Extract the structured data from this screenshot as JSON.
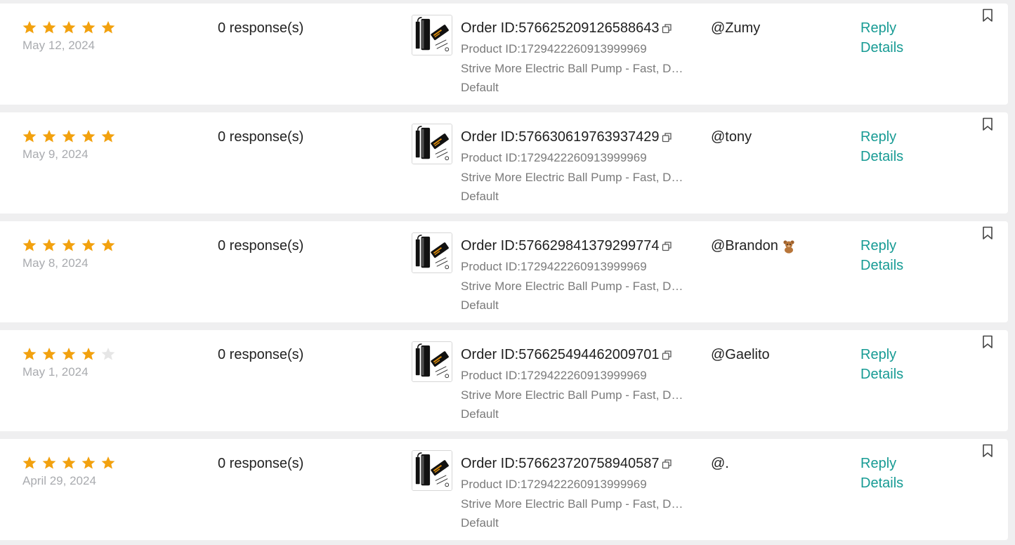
{
  "colors": {
    "star_filled": "#f2a10e",
    "star_empty": "#e6e6e6",
    "link": "#179b94",
    "page_background": "#efeff0",
    "card_background": "#ffffff"
  },
  "icons": {
    "star": "star-icon",
    "copy": "copy-icon",
    "bookmark": "bookmark-icon",
    "product_image": "electric-ball-pump-thumbnail"
  },
  "reviews": [
    {
      "rating": 5,
      "date": "May 12, 2024",
      "responses": "0 response(s)",
      "order_id": "Order ID:576625209126588643",
      "product_id": "Product ID:1729422260913999969",
      "product_name": "Strive More Electric Ball Pump - Fast, Durable",
      "variant": "Default",
      "username": "@Zumy",
      "user_emoji": "",
      "reply_label": "Reply",
      "details_label": "Details"
    },
    {
      "rating": 5,
      "date": "May 9, 2024",
      "responses": "0 response(s)",
      "order_id": "Order ID:576630619763937429",
      "product_id": "Product ID:1729422260913999969",
      "product_name": "Strive More Electric Ball Pump - Fast, Durable",
      "variant": "Default",
      "username": "@tony",
      "user_emoji": "",
      "reply_label": "Reply",
      "details_label": "Details"
    },
    {
      "rating": 5,
      "date": "May 8, 2024",
      "responses": "0 response(s)",
      "order_id": "Order ID:576629841379299774",
      "product_id": "Product ID:1729422260913999969",
      "product_name": "Strive More Electric Ball Pump - Fast, Durable",
      "variant": "Default",
      "username": "@Brandon",
      "user_emoji": "teddy-bear-emoji",
      "reply_label": "Reply",
      "details_label": "Details"
    },
    {
      "rating": 4,
      "date": "May 1, 2024",
      "responses": "0 response(s)",
      "order_id": "Order ID:576625494462009701",
      "product_id": "Product ID:1729422260913999969",
      "product_name": "Strive More Electric Ball Pump - Fast, Durable",
      "variant": "Default",
      "username": "@Gaelito",
      "user_emoji": "",
      "reply_label": "Reply",
      "details_label": "Details"
    },
    {
      "rating": 5,
      "date": "April 29, 2024",
      "responses": "0 response(s)",
      "order_id": "Order ID:576623720758940587",
      "product_id": "Product ID:1729422260913999969",
      "product_name": "Strive More Electric Ball Pump - Fast, Durable",
      "variant": "Default",
      "username": "@.",
      "user_emoji": "",
      "reply_label": "Reply",
      "details_label": "Details"
    }
  ]
}
